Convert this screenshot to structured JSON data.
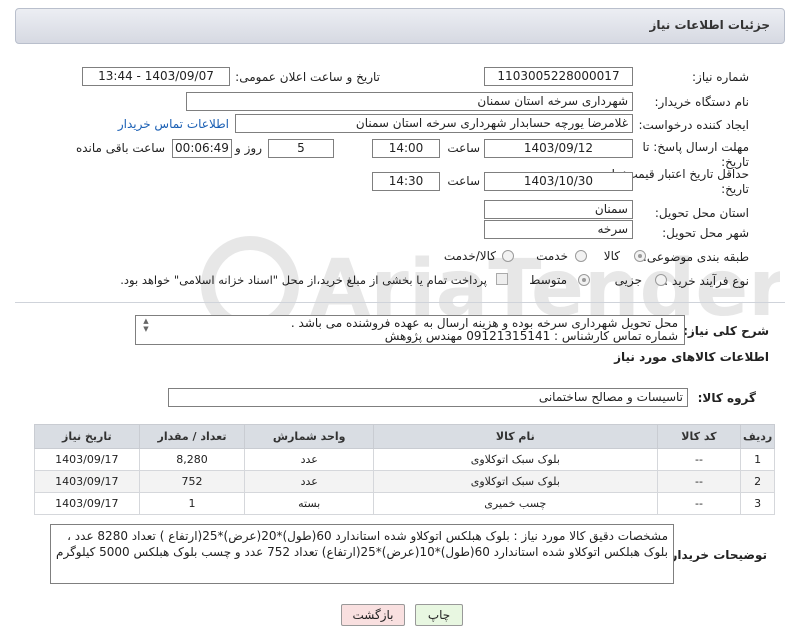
{
  "panel": {
    "title": "جزئیات اطلاعات نیاز"
  },
  "fields": {
    "need_number_label": "شماره نیاز:",
    "need_number": "1103005228000017",
    "announce_label": "تاریخ و ساعت اعلان عمومی:",
    "announce_value": "1403/09/07 - 13:44",
    "buyer_org_label": "نام دستگاه خریدار:",
    "buyer_org": "شهرداری سرخه استان سمنان",
    "requester_label": "ایجاد کننده درخواست:",
    "requester": "غلامرضا یورچه حسابدار شهرداری سرخه استان سمنان",
    "buyer_contact_link": "اطلاعات تماس خریدار",
    "deadline_label_1": "مهلت ارسال پاسخ: تا",
    "deadline_label_2": "تاریخ:",
    "deadline_date": "1403/09/12",
    "time_label": "ساعت",
    "deadline_time": "14:00",
    "days_value": "5",
    "days_label": "روز و",
    "remaining_time": "00:06:49",
    "remaining_label": "ساعت باقی مانده",
    "validity_label_1": "حداقل تاریخ اعتبار قیمت: تا",
    "validity_label_2": "تاریخ:",
    "validity_date": "1403/10/30",
    "validity_time": "14:30",
    "province_label": "استان محل تحویل:",
    "province": "سمنان",
    "city_label": "شهر محل تحویل:",
    "city": "سرخه",
    "category_label": "طبقه بندی موضوعی:",
    "category_options": [
      "کالا",
      "خدمت",
      "کالا/خدمت"
    ],
    "process_label": "نوع فرآیند خرید :",
    "process_options": [
      "جزیی",
      "متوسط"
    ],
    "payment_note": "پرداخت تمام یا بخشی از مبلغ خرید،از محل \"اسناد خزانه اسلامی\" خواهد بود."
  },
  "description": {
    "label": "شرح کلی نیاز:",
    "line1": "محل تحویل شهرداری سرخه بوده و هزینه ارسال به عهده فروشنده می باشد .",
    "line2": "شماره تماس کارشناس : 09121315141 مهندس پژوهش"
  },
  "goods": {
    "section_title": "اطلاعات کالاهای مورد نیاز",
    "group_label": "گروه کالا:",
    "group_value": "تاسیسات و مصالح ساختمانی",
    "columns": [
      "ردیف",
      "کد کالا",
      "نام کالا",
      "واحد شمارش",
      "تعداد / مقدار",
      "تاریخ نیاز"
    ],
    "rows": [
      {
        "row": "1",
        "code": "--",
        "name": "بلوک سبک اتوکلاوی",
        "unit": "عدد",
        "qty": "8,280",
        "date": "1403/09/17"
      },
      {
        "row": "2",
        "code": "--",
        "name": "بلوک سبک اتوکلاوی",
        "unit": "عدد",
        "qty": "752",
        "date": "1403/09/17"
      },
      {
        "row": "3",
        "code": "--",
        "name": "چسب خمیری",
        "unit": "بسته",
        "qty": "1",
        "date": "1403/09/17"
      }
    ]
  },
  "buyer_notes": {
    "label": "توضیحات خریدار:",
    "text": "مشخصات دقیق کالا مورد نیاز : بلوک هبلکس اتوکلاو شده استاندارد 60(طول)*20(عرض)*25(ارتفاع ) تعداد 8280 عدد ، بلوک هبلکس اتوکلاو شده استاندارد 60(طول)*10(عرض)*25(ارتفاع) تعداد 752 عدد و چسب بلوک هبلکس 5000 کیلوگرم"
  },
  "buttons": {
    "print": "چاپ",
    "back": "بازگشت"
  },
  "watermark": "AriaTender.neT",
  "colors": {
    "link": "#1a5fb4",
    "print_bg": "#e8f7e1",
    "back_bg": "#f9e0e0"
  }
}
